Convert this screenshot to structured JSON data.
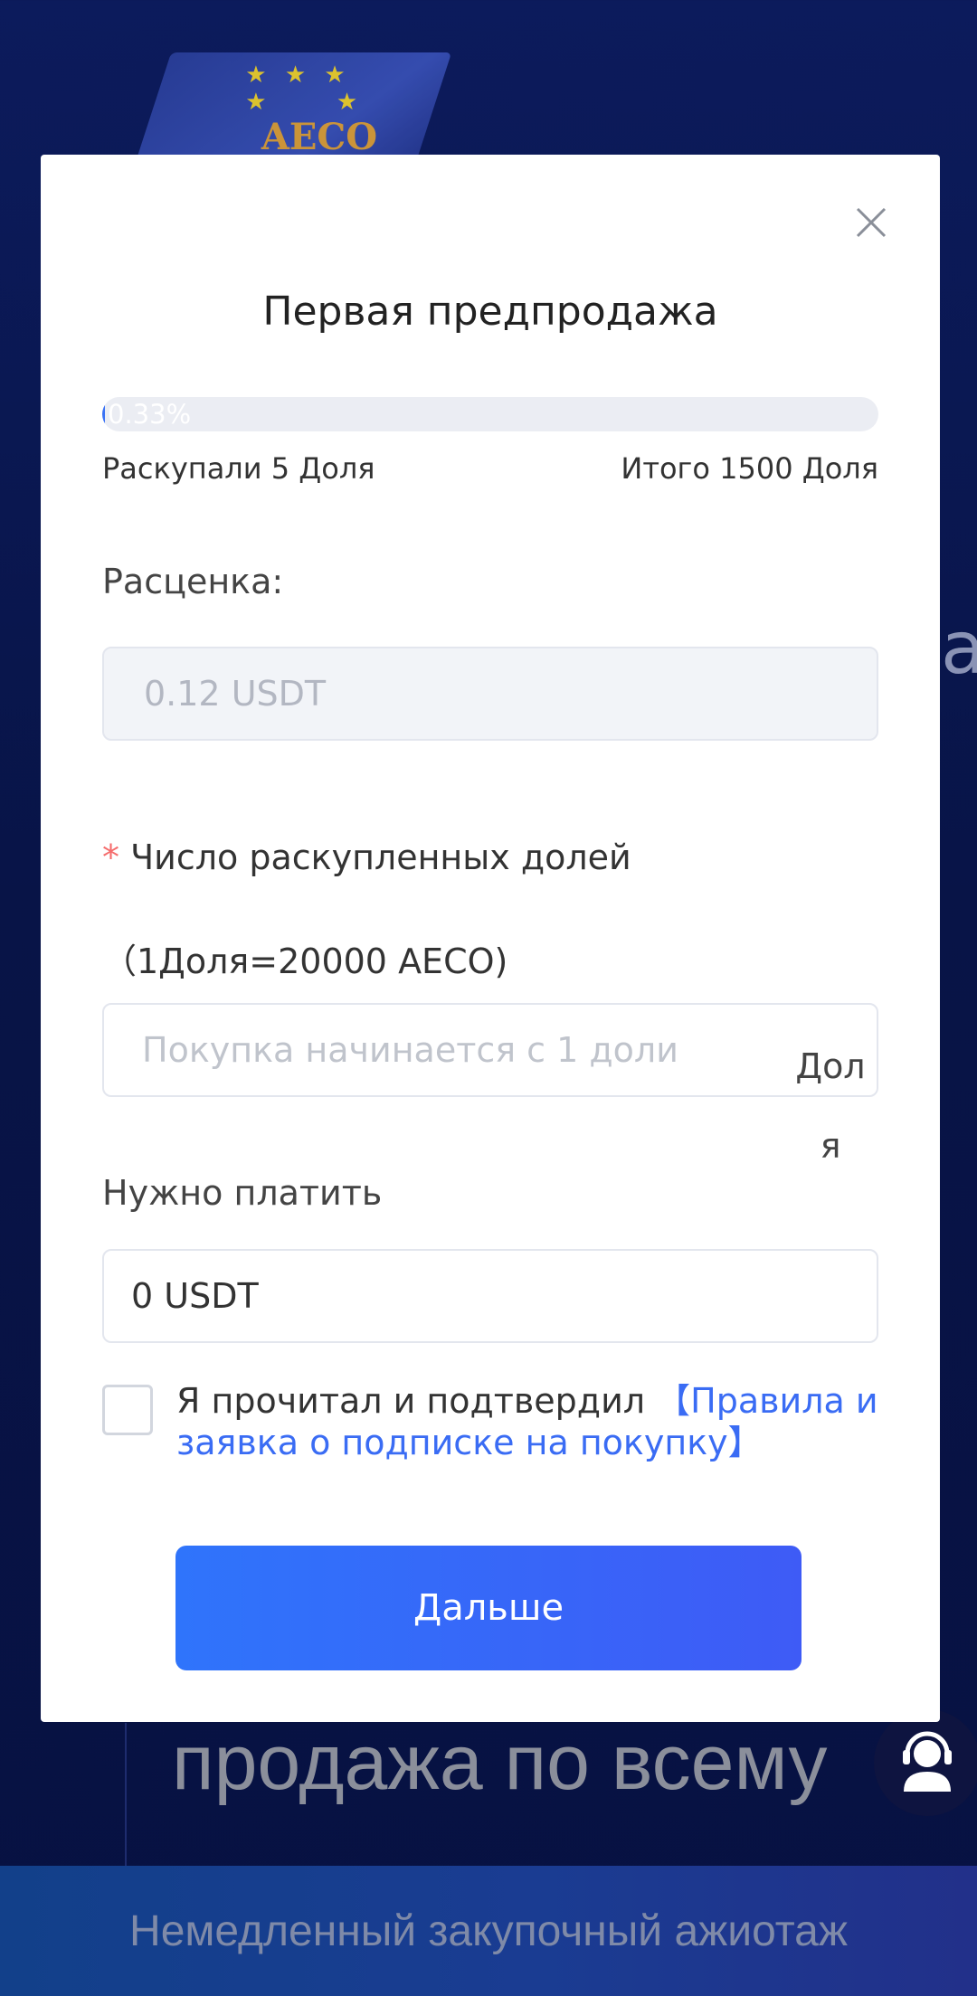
{
  "background": {
    "logo_text": "AECO",
    "side_letter": "a",
    "headline": "продажа по всему",
    "banner": "Немедленный закупочный ажиотаж"
  },
  "modal": {
    "title": "Первая предпродажа",
    "progress": {
      "percent": 0.33,
      "percent_label": "0.33%",
      "sold_label": "Раскупали 5 Доля",
      "total_label": "Итого 1500 Доля"
    },
    "price": {
      "label": "Расценка:",
      "value": "0.12 USDT"
    },
    "quantity": {
      "required_mark": "*",
      "label": " Число раскупленных долей（1Доля=20000 AECO)",
      "placeholder": "Покупка начинается с 1 доли",
      "value": "",
      "unit": "Доля"
    },
    "payment": {
      "label": "Нужно платить",
      "value": "0 USDT"
    },
    "agreement": {
      "checked": false,
      "text": "Я прочитал и подтвердил ",
      "link": "【Правила и заявка о подписке на покупку】"
    },
    "next_button": "Дальше"
  },
  "colors": {
    "accent": "#3a6cf4",
    "required": "#f56c6c",
    "background": "#0a1650"
  },
  "icons": {
    "close": "close-icon",
    "support": "headset-agent-icon"
  }
}
